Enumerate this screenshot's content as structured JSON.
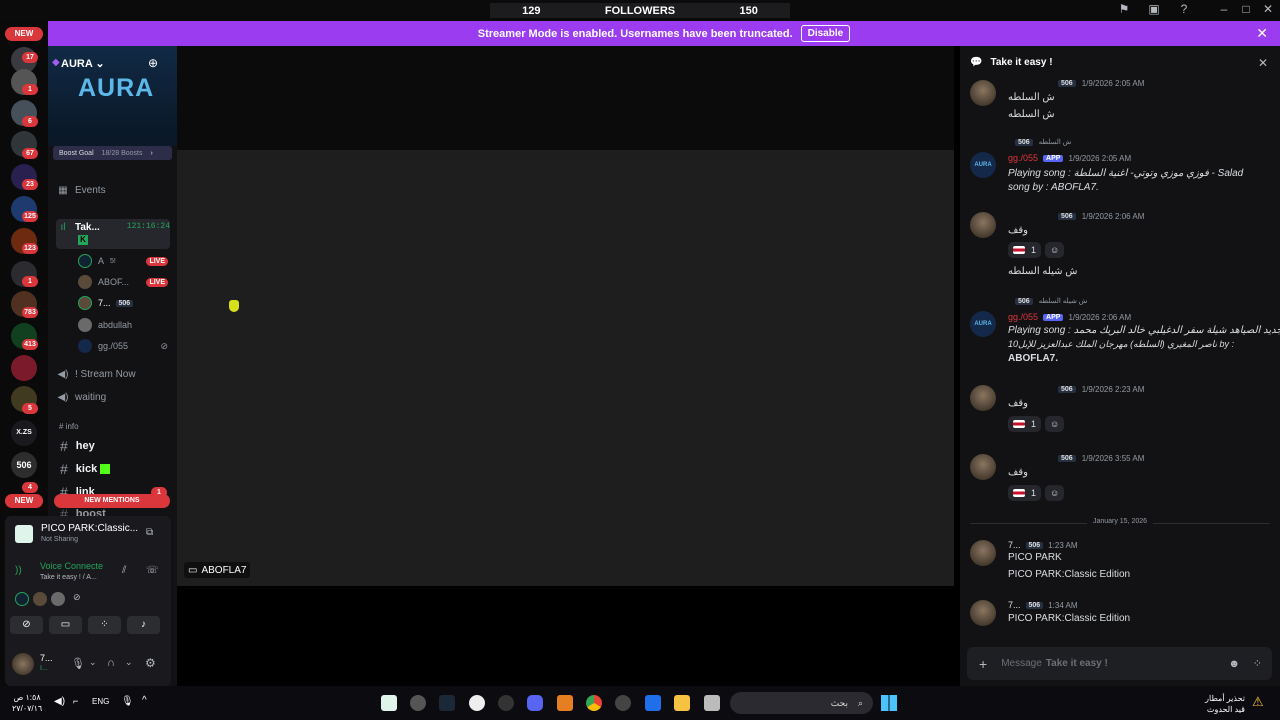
{
  "topbar": {
    "followers_left": "129",
    "followers_label": "FOLLOWERS",
    "followers_right": "150"
  },
  "banner": {
    "text": "Streamer Mode is enabled. Usernames have been truncated.",
    "button": "Disable"
  },
  "server_rail": {
    "new_top": "NEW",
    "new_bottom": "NEW",
    "badges": [
      "6",
      "17",
      "1",
      "6",
      "67",
      "23",
      "125",
      "123",
      "1",
      "783",
      "413",
      "5",
      "4"
    ],
    "xzs": "X.ZS",
    "num506": "506"
  },
  "sidebar": {
    "server_name": "AURA",
    "logo": "AURA",
    "boost_goal_label": "Boost Goal",
    "boost_goal_value": "18/28 Boosts",
    "events": "Events",
    "voice_channel": {
      "name": "Tak...",
      "timer": "121:16:24",
      "sub": "K"
    },
    "voice_users": [
      {
        "name": "A",
        "extra": "5!",
        "live": "LIVE"
      },
      {
        "name": "ABOF...",
        "live": "LIVE"
      },
      {
        "name": "7...",
        "tag": "506"
      },
      {
        "name": "abdullah"
      },
      {
        "name": "gg./055"
      }
    ],
    "stream_now": "! Stream Now",
    "waiting": "waiting",
    "category": "# info",
    "text_channels": [
      "hey",
      "kick",
      "link",
      "boost"
    ],
    "link_badge": "1",
    "new_mentions": "NEW MENTIONS"
  },
  "bottom_panel": {
    "activity_title": "PICO PARK:Classic...",
    "activity_sub": "Not Sharing",
    "voice_status": "Voice Connecte",
    "voice_channel": "Take it easy ! / A...",
    "user_name": "7...",
    "user_sub": "I..."
  },
  "stream": {
    "label": "ABOFLA7"
  },
  "chat": {
    "title": "Take it easy !",
    "messages": [
      {
        "tag": "506",
        "time": "1/9/2026 2:05 AM",
        "lines": [
          "ش السلطه",
          "ش السلطه"
        ]
      },
      {
        "reply_to": "ش السلطه",
        "reply_tag": "506",
        "author": "gg./055",
        "app": "APP",
        "time": "1/9/2026 2:05 AM",
        "lines": [
          "Playing song : فوزي موزي وتوتي- اغنية السلطة - Salad",
          "song by : ABOFLA7."
        ]
      },
      {
        "tag": "506",
        "time": "1/9/2026 2:06 AM",
        "lines": [
          "وقف"
        ],
        "reaction": "1",
        "after": "ش شيله السلطه"
      },
      {
        "reply_to": "ش شيله السلطه",
        "reply_tag": "506",
        "author": "gg./055",
        "app": "APP",
        "time": "1/9/2026 2:06 AM",
        "lines": [
          "Playing song : جديد الصياهد شيلة سفر الدغيلبي خالد البريك محمد",
          "ناصر المغيري (السلطه) مهرجان الملك عبدالعزيز للإبل10 by :",
          "ABOFLA7."
        ]
      },
      {
        "tag": "506",
        "time": "1/9/2026 2:23 AM",
        "lines": [
          "وقف"
        ],
        "reaction": "1"
      },
      {
        "tag": "506",
        "time": "1/9/2026 3:55 AM",
        "lines": [
          "وقف"
        ],
        "reaction": "1"
      }
    ],
    "date_divider": "January 15, 2026",
    "messages2": [
      {
        "author": "7...",
        "tag": "506",
        "time": "1:23 AM",
        "lines": [
          "PICO PARK",
          "PICO PARK:Classic Edition"
        ]
      },
      {
        "author": "7...",
        "tag": "506",
        "time": "1:34 AM",
        "lines": [
          "PICO PARK:Classic Edition"
        ]
      }
    ],
    "input_placeholder_prefix": "Message",
    "input_placeholder_channel": "Take it easy !"
  },
  "taskbar": {
    "time": "١:٥٨ ص",
    "date": "٢٧/٠٧/١٦",
    "lang": "ENG",
    "search": "بحث",
    "notice_line1": "تحذير أمطار",
    "notice_line2": "قيد الحدوث"
  },
  "colors": {
    "banner": "#9b3cf0",
    "live": "#da373c",
    "app": "#5865f2",
    "accent_green": "#23a55a"
  }
}
